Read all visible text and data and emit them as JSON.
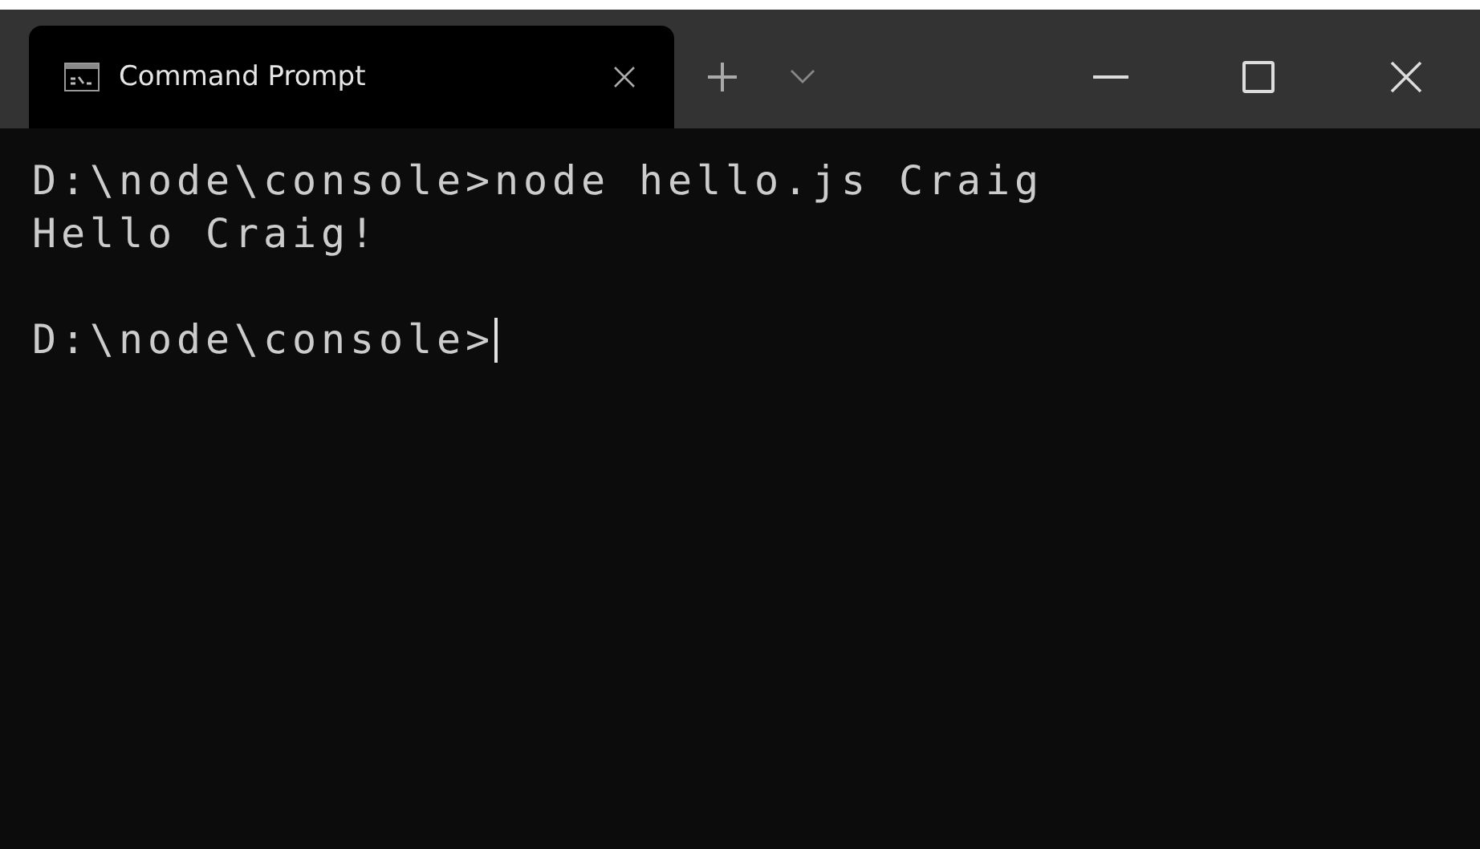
{
  "tabs": [
    {
      "title": "Command Prompt",
      "selected": true
    }
  ],
  "terminal": {
    "lines": [
      {
        "kind": "output",
        "text": "D:\\node\\console>node hello.js Craig"
      },
      {
        "kind": "output",
        "text": "Hello Craig!"
      },
      {
        "kind": "blank"
      },
      {
        "kind": "prompt",
        "text": "D:\\node\\console>"
      }
    ]
  }
}
